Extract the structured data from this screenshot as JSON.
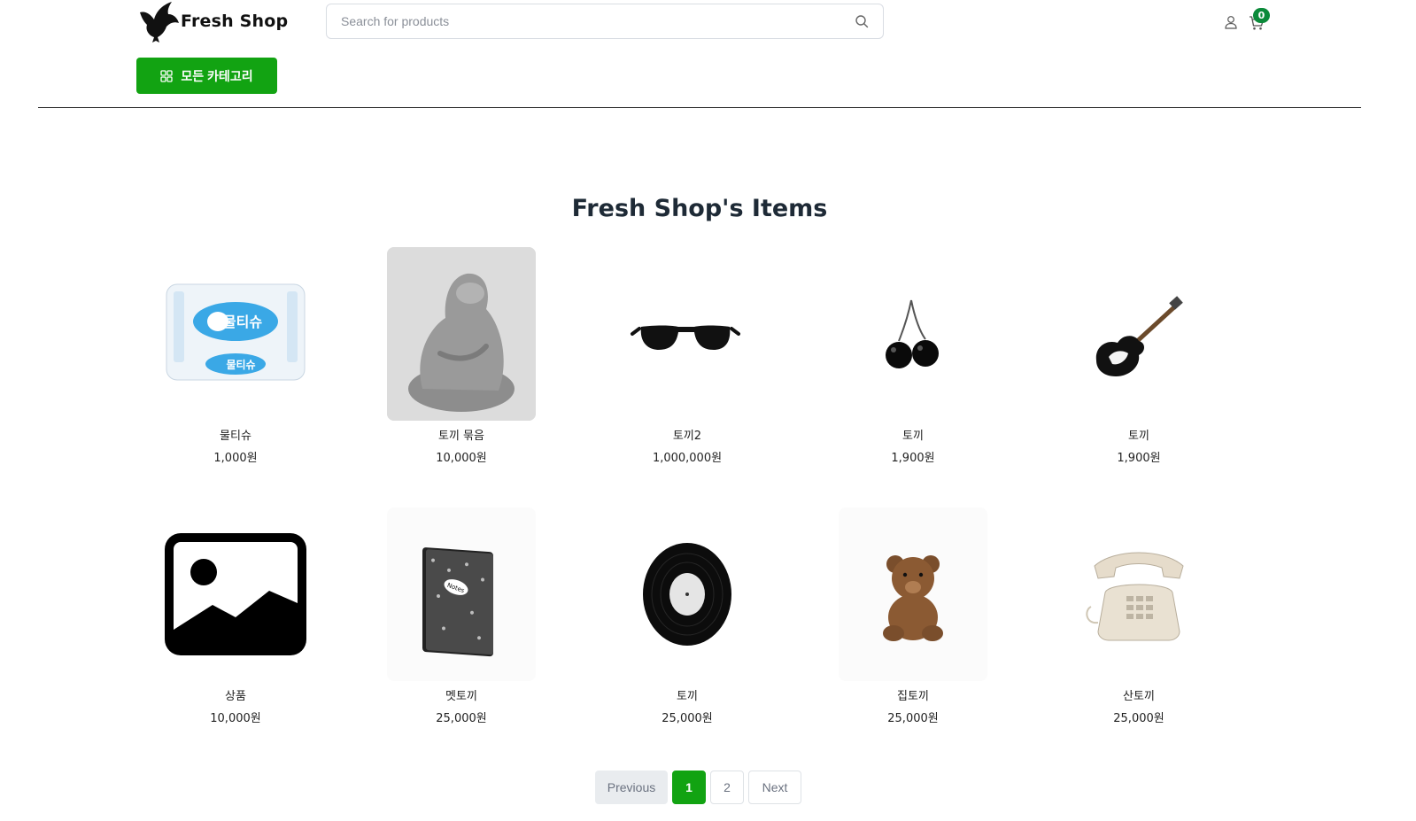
{
  "header": {
    "logo_text": "Fresh Shop",
    "search_placeholder": "Search for products",
    "cart_count": "0",
    "category_button": "모든 카테고리"
  },
  "main": {
    "title": "Fresh Shop's Items",
    "products": [
      {
        "name": "물티슈",
        "price": "1,000원",
        "image": "wet-wipes"
      },
      {
        "name": "토끼 묶음",
        "price": "10,000원",
        "image": "grey-creature-figure"
      },
      {
        "name": "토끼2",
        "price": "1,000,000원",
        "image": "sunglasses"
      },
      {
        "name": "토끼",
        "price": "1,900원",
        "image": "cherries"
      },
      {
        "name": "토끼",
        "price": "1,900원",
        "image": "electric-guitar"
      },
      {
        "name": "상품",
        "price": "10,000원",
        "image": "image-placeholder"
      },
      {
        "name": "멧토끼",
        "price": "25,000원",
        "image": "notebook"
      },
      {
        "name": "토끼",
        "price": "25,000원",
        "image": "vinyl-record"
      },
      {
        "name": "집토끼",
        "price": "25,000원",
        "image": "teddy-bear"
      },
      {
        "name": "산토끼",
        "price": "25,000원",
        "image": "telephone"
      }
    ]
  },
  "pagination": {
    "previous": "Previous",
    "pages": [
      "1",
      "2"
    ],
    "active_page": "1",
    "next": "Next"
  },
  "colors": {
    "accent": "#12a312",
    "badge": "#0b8a3a"
  }
}
